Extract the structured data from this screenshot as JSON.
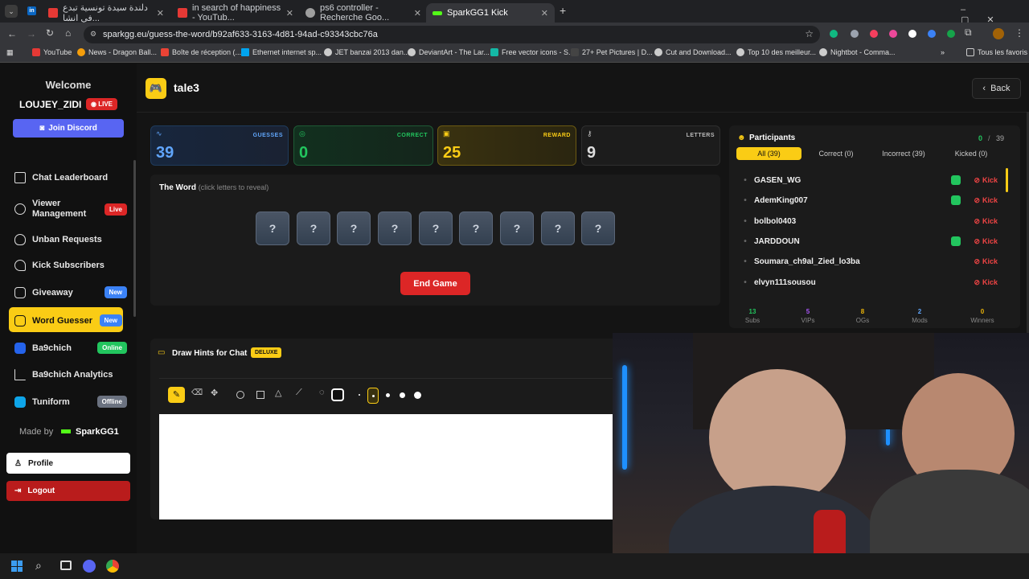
{
  "browser": {
    "tabs": [
      {
        "title": "دلندة سيدة تونسية تبدع في انشا...",
        "color": "#e53935"
      },
      {
        "title": "in search of happiness - YouTub...",
        "color": "#e53935"
      },
      {
        "title": "ps6 controller - Recherche Goo...",
        "color": "#9e9e9e"
      },
      {
        "title": "SparkGG1 Kick",
        "color": "#53fc18"
      }
    ],
    "url": "sparkgg.eu/guess-the-word/b92af633-3163-4d81-94ad-c93343cbc76a",
    "bookmarks": [
      "YouTube",
      "News - Dragon Ball...",
      "Boîte de réception (...",
      "Ethernet internet sp...",
      "JET banzai 2013 dan...",
      "DeviantArt - The Lar...",
      "Free vector icons - S...",
      "27+ Pet Pictures | D...",
      "Cut and Download...",
      "Top 10 des meilleur...",
      "Nightbot - Comma..."
    ],
    "all_bookmarks": "Tous les favoris"
  },
  "sidebar": {
    "welcome": "Welcome",
    "username": "LOUJEY_ZIDI",
    "live_badge": "LIVE",
    "discord_button": "Join Discord",
    "items": [
      {
        "label": "Chat Leaderboard",
        "badge": ""
      },
      {
        "label": "Viewer Management",
        "badge": "Live"
      },
      {
        "label": "Unban Requests",
        "badge": ""
      },
      {
        "label": "Kick Subscribers",
        "badge": ""
      },
      {
        "label": "Giveaway",
        "badge": "New"
      },
      {
        "label": "Word Guesser",
        "badge": "New"
      },
      {
        "label": "Ba9chich",
        "badge": "Online"
      },
      {
        "label": "Ba9chich Analytics",
        "badge": ""
      },
      {
        "label": "Tuniform",
        "badge": "Offline"
      }
    ],
    "made_by": "Made by",
    "maker": "SparkGG1",
    "profile": "Profile",
    "logout": "Logout"
  },
  "header": {
    "title": "tale3",
    "back": "Back"
  },
  "stats": [
    {
      "label": "GUESSES",
      "value": "39"
    },
    {
      "label": "CORRECT",
      "value": "0"
    },
    {
      "label": "REWARD",
      "value": "25"
    },
    {
      "label": "LETTERS",
      "value": "9"
    }
  ],
  "word": {
    "title": "The Word",
    "hint": "(click letters to reveal)",
    "tiles": [
      "?",
      "?",
      "?",
      "?",
      "?",
      "?",
      "?",
      "?",
      "?"
    ],
    "end_button": "End Game"
  },
  "draw": {
    "title": "Draw Hints for Chat",
    "badge": "DELUXE"
  },
  "participants": {
    "title": "Participants",
    "correct_count": "0",
    "total": "39",
    "filters": [
      "All (39)",
      "Correct (0)",
      "Incorrect (39)",
      "Kicked (0)"
    ],
    "kick_label": "Kick",
    "list": [
      {
        "name": "GASEN_WG",
        "badge": true
      },
      {
        "name": "AdemKing007",
        "badge": true
      },
      {
        "name": "bolbol0403",
        "badge": false
      },
      {
        "name": "JARDDOUN",
        "badge": true
      },
      {
        "name": "Soumara_ch9al_Zied_lo3ba",
        "badge": false
      },
      {
        "name": "elvyn111sousou",
        "badge": false
      }
    ],
    "footer": [
      {
        "value": "13",
        "label": "Subs",
        "color": "#22c55e"
      },
      {
        "value": "5",
        "label": "VIPs",
        "color": "#a855f7"
      },
      {
        "value": "8",
        "label": "OGs",
        "color": "#eab308"
      },
      {
        "value": "2",
        "label": "Mods",
        "color": "#60a5fa"
      },
      {
        "value": "0",
        "label": "Winners",
        "color": "#eab308"
      }
    ]
  }
}
